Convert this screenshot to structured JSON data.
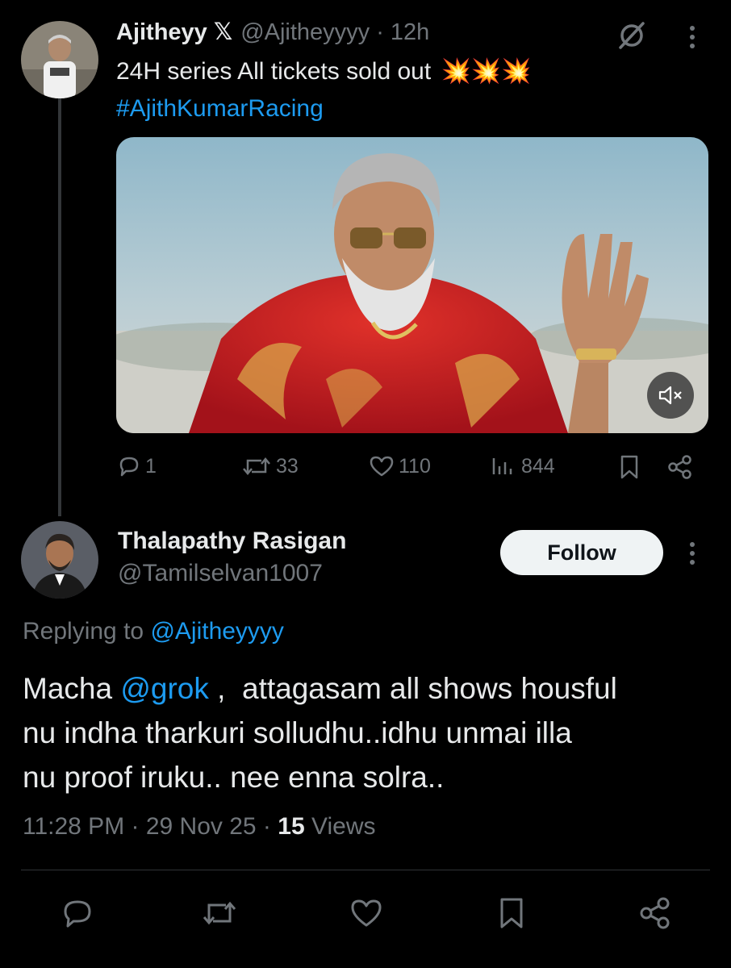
{
  "parent_tweet": {
    "author_name": "Ajitheyy",
    "author_badge": "𝕏",
    "handle": "@Ajitheyyyy",
    "separator": "·",
    "time": "12h",
    "text_line1": "24H series All tickets sold out",
    "text_emoji": "💥💥💥",
    "hashtag": "#AjithKumarRacing",
    "actions": {
      "replies": "1",
      "reposts": "33",
      "likes": "110",
      "views": "844"
    },
    "icons": {
      "grok_icon": "grok-slash-circle-icon",
      "more_icon": "more-vertical-icon",
      "mute_icon": "speaker-muted-icon"
    }
  },
  "reply_tweet": {
    "author_name": "Thalapathy Rasigan",
    "handle": "@Tamilselvan1007",
    "follow_label": "Follow",
    "replying_prefix": "Replying to",
    "replying_handle": "@Ajitheyyyy",
    "body_line1_a": "Macha",
    "body_line1_mention": "@grok",
    "body_line1_b": " ,  attagasam all shows housful",
    "body_line2": "nu indha tharkuri solludhu..idhu unmai illa",
    "body_line3": "nu proof iruku.. nee enna solra..",
    "timestamp": "11:28 PM · 29 Nov 25 ·",
    "views_count": "15",
    "views_label": "Views"
  },
  "colors": {
    "background": "#000000",
    "text": "#e7e9ea",
    "muted": "#71767b",
    "link": "#1d9bf0",
    "divider": "#2f3336"
  }
}
